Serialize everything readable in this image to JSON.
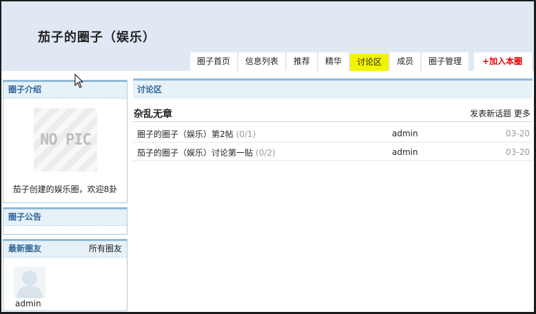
{
  "header": {
    "title": "茄子的圈子（娱乐）",
    "tabs": [
      {
        "label": "圈子首页"
      },
      {
        "label": "信息列表"
      },
      {
        "label": "推荐"
      },
      {
        "label": "精华"
      },
      {
        "label": "讨论区",
        "active": true
      },
      {
        "label": "成员"
      },
      {
        "label": "圈子管理"
      },
      {
        "label": "+加入本圈"
      }
    ]
  },
  "sidebar": {
    "intro": {
      "title": "圈子介绍",
      "image_text": "NO PIC",
      "text": "茄子创建的娱乐圈，欢迎8卦"
    },
    "notice": {
      "title": "圈子公告"
    },
    "members": {
      "title": "最新圈友",
      "all_link": "所有圈友",
      "items": [
        {
          "name": "admin"
        }
      ]
    }
  },
  "main": {
    "section_title": "讨论区",
    "board": {
      "title": "杂乱无章",
      "new_topic": "发表新话题",
      "more": "更多"
    },
    "topics": [
      {
        "title": "圈子的圈子（娱乐）第2帖",
        "count": "(0/1)",
        "author": "admin",
        "date": "03-20"
      },
      {
        "title": "茄子的圈子（娱乐）讨论第一贴",
        "count": "(0/2)",
        "author": "admin",
        "date": "03-20"
      }
    ]
  },
  "colors": {
    "header_bg": "#e0e8f4",
    "active_tab": "#f4f400",
    "join_text": "#e00000",
    "panel_title": "#336699"
  }
}
